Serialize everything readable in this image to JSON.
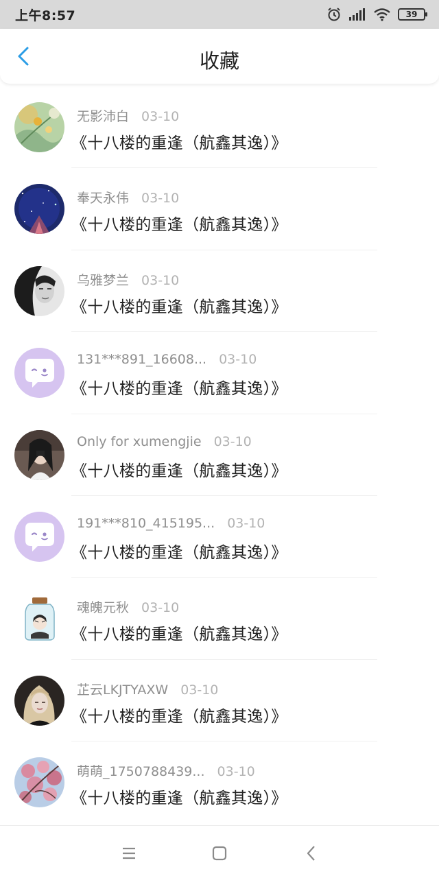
{
  "status_bar": {
    "time": "上午8:57",
    "battery": "39",
    "icons": [
      "alarm-icon",
      "signal-icon",
      "wifi-icon",
      "battery-icon"
    ]
  },
  "nav": {
    "back_icon": "chevron-left-icon",
    "title": "收藏",
    "accent_color": "#2b9de6"
  },
  "items": [
    {
      "author": "无影沛白",
      "date": "03-10",
      "title": "《十八楼的重逢（航鑫其逸）》",
      "avatar": "floral-painting"
    },
    {
      "author": "奉天永伟",
      "date": "03-10",
      "title": "《十八楼的重逢（航鑫其逸）》",
      "avatar": "starry-night"
    },
    {
      "author": "乌雅梦兰",
      "date": "03-10",
      "title": "《十八楼的重逢（航鑫其逸）》",
      "avatar": "bw-portrait"
    },
    {
      "author": "131***891_16608...",
      "date": "03-10",
      "title": "《十八楼的重逢（航鑫其逸）》",
      "avatar": "default-chat-bubble"
    },
    {
      "author": "Only for xumengjie",
      "date": "03-10",
      "title": "《十八楼的重逢（航鑫其逸）》",
      "avatar": "photo-girl"
    },
    {
      "author": "191***810_415195...",
      "date": "03-10",
      "title": "《十八楼的重逢（航鑫其逸）》",
      "avatar": "default-chat-bubble"
    },
    {
      "author": "魂魄元秋",
      "date": "03-10",
      "title": "《十八楼的重逢（航鑫其逸）》",
      "avatar": "jar-illustration"
    },
    {
      "author": "芷云LKJTYAXW",
      "date": "03-10",
      "title": "《十八楼的重逢（航鑫其逸）》",
      "avatar": "blonde-portrait"
    },
    {
      "author": "萌萌_1750788439...",
      "date": "03-10",
      "title": "《十八楼的重逢（航鑫其逸）》",
      "avatar": "cherry-blossom"
    }
  ],
  "bottom_nav": {
    "icons": [
      "menu-icon",
      "home-square-icon",
      "back-triangle-icon"
    ]
  }
}
